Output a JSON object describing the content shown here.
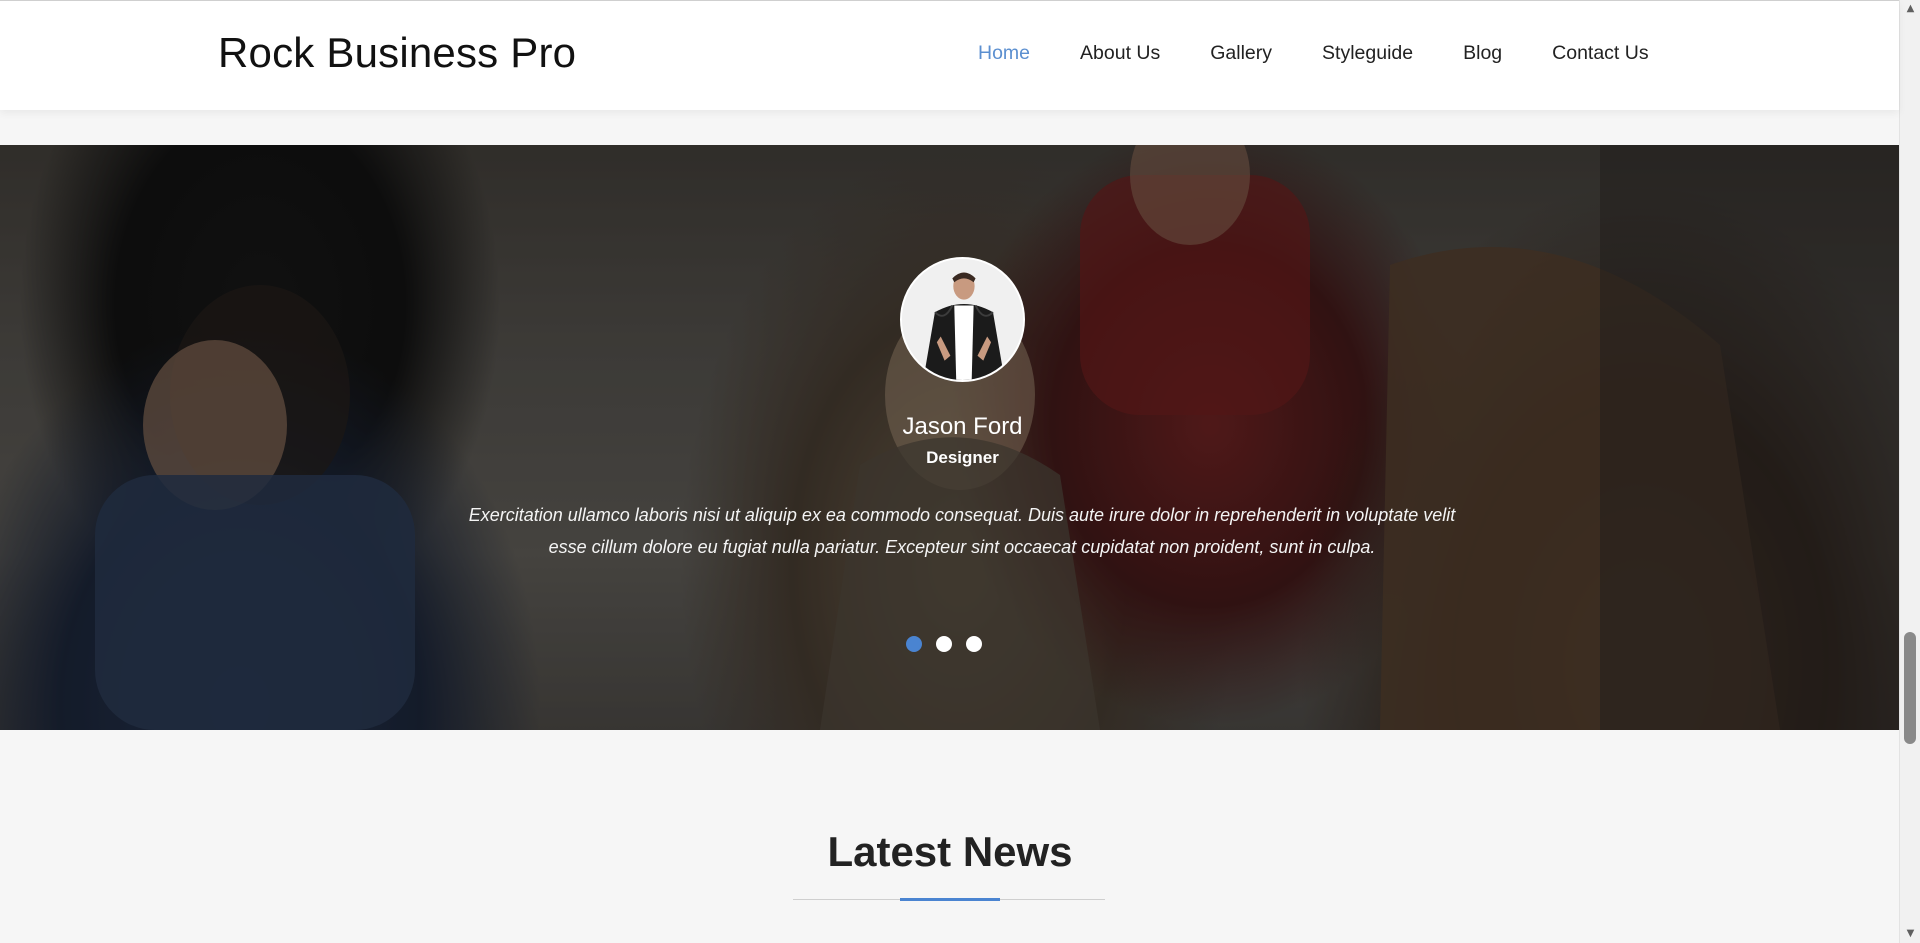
{
  "header": {
    "brand": "Rock Business Pro",
    "nav": [
      {
        "label": "Home",
        "active": true
      },
      {
        "label": "About Us",
        "active": false
      },
      {
        "label": "Gallery",
        "active": false
      },
      {
        "label": "Styleguide",
        "active": false
      },
      {
        "label": "Blog",
        "active": false
      },
      {
        "label": "Contact Us",
        "active": false
      }
    ]
  },
  "testimonial": {
    "name": "Jason Ford",
    "role": "Designer",
    "quote": "Exercitation ullamco laboris nisi ut aliquip ex ea commodo consequat. Duis aute irure dolor in reprehenderit in voluptate velit esse cillum dolore eu fugiat nulla pariatur. Excepteur sint occaecat cupidatat non proident, sunt in culpa.",
    "slides_total": 3,
    "active_slide": 1
  },
  "news": {
    "title": "Latest News"
  },
  "colors": {
    "accent": "#4a84d1",
    "nav_active": "#5b8fd0",
    "header_bg": "#ffffff",
    "page_bg": "#f6f6f6"
  },
  "icons": {
    "scroll_up": "scroll-up-arrow-icon",
    "scroll_down": "scroll-down-arrow-icon"
  }
}
